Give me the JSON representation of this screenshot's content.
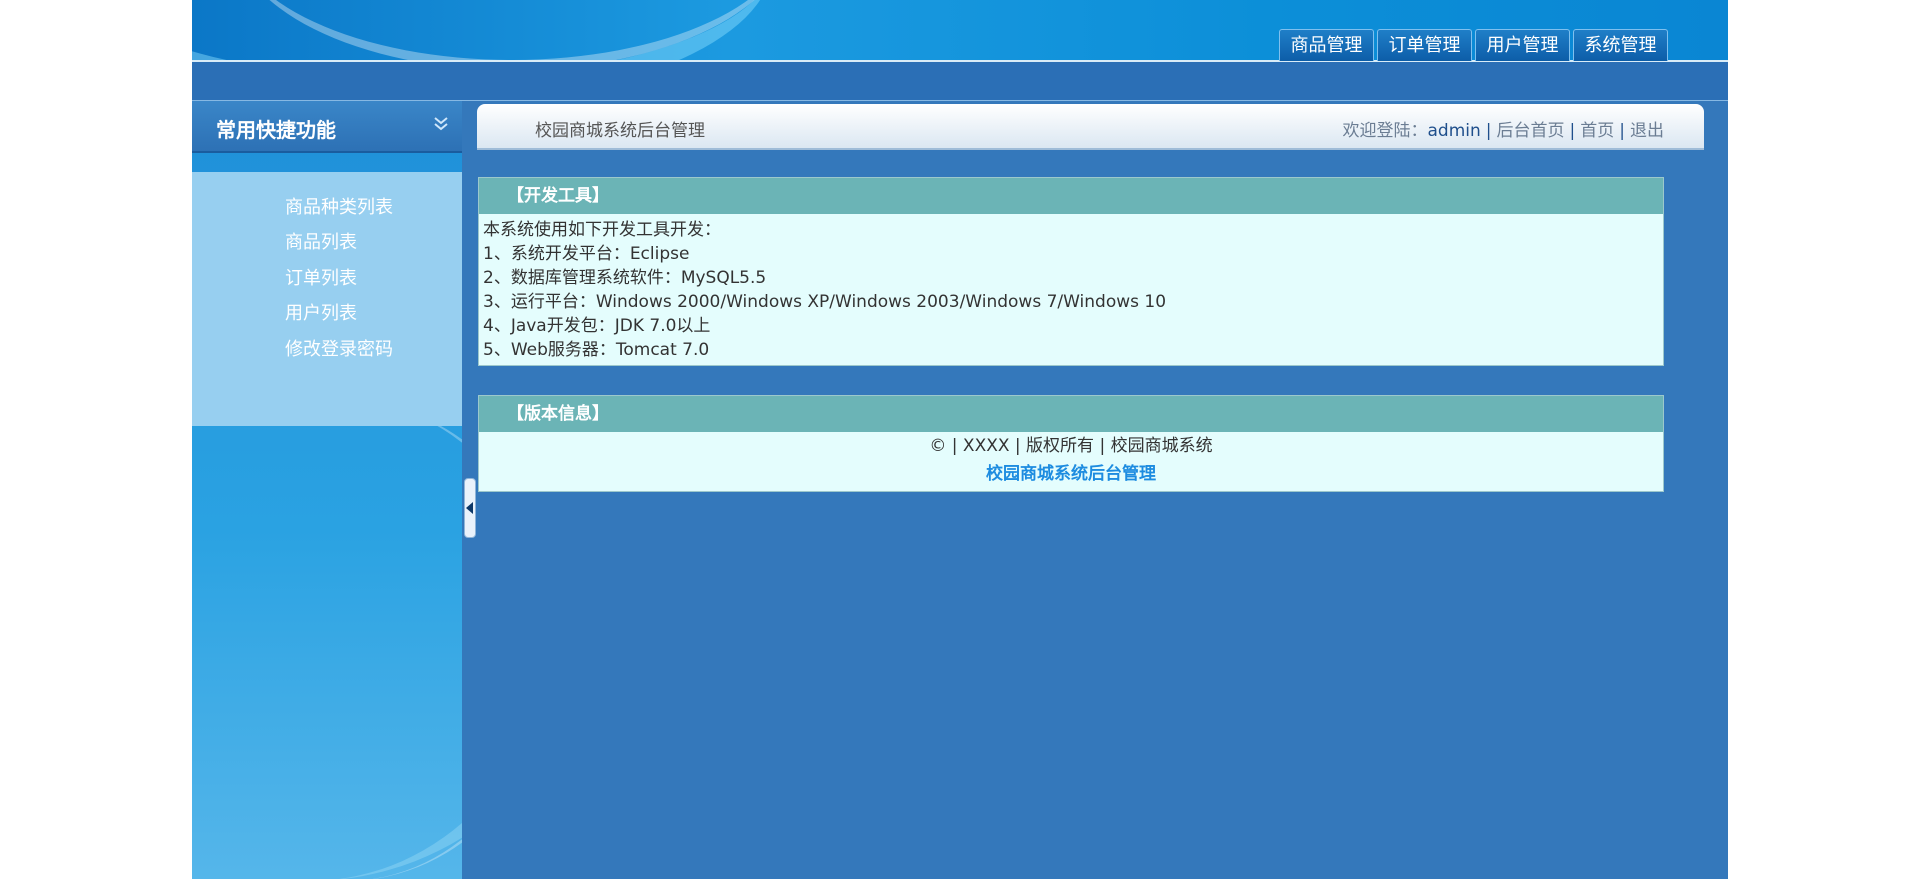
{
  "header": {
    "nav": [
      "商品管理",
      "订单管理",
      "用户管理",
      "系统管理"
    ]
  },
  "sidebar": {
    "title": "常用快捷功能",
    "items": [
      "商品种类列表",
      "商品列表",
      "订单列表",
      "用户列表",
      "修改登录密码"
    ]
  },
  "crumb": {
    "system_name": "校园商城系统后台管理",
    "welcome": "欢迎登陆：",
    "user": "admin",
    "links": [
      "后台首页",
      "首页",
      "退出"
    ]
  },
  "dev_panel": {
    "title": "【开发工具】",
    "lines": [
      "本系统使用如下开发工具开发：",
      "1、系统开发平台：Eclipse",
      "2、数据库管理系统软件：MySQL5.5",
      "3、运行平台：Windows 2000/Windows XP/Windows 2003/Windows 7/Windows 10",
      "4、Java开发包：JDK 7.0以上",
      "5、Web服务器：Tomcat 7.0"
    ]
  },
  "version_panel": {
    "title": "【版本信息】",
    "copyright": "©  | XXXX | 版权所有 | 校园商城系统",
    "brand": "校园商城系统后台管理"
  },
  "colors": {
    "page_blue": "#3478bb",
    "panel_header": "#6bb4b6",
    "panel_body": "#e4fdfd",
    "menu_bg": "#97cff0",
    "brand_link": "#1d8ce0"
  }
}
